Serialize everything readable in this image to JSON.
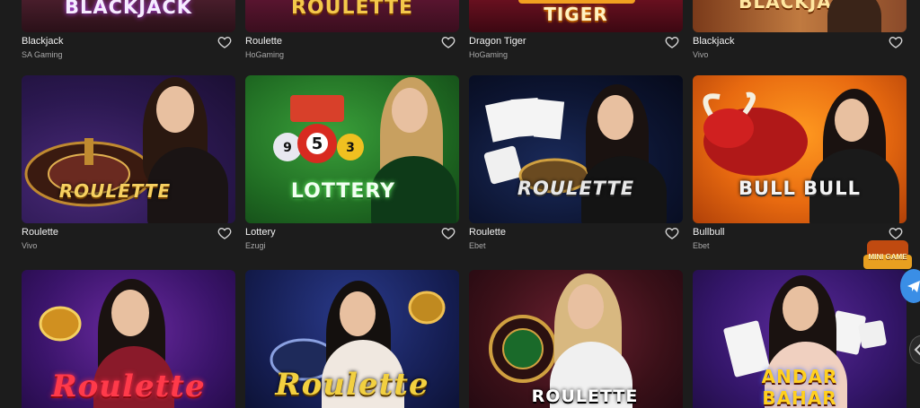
{
  "games": [
    {
      "title": "Blackjack",
      "provider": "SA Gaming",
      "logo": "BLACKJACK"
    },
    {
      "title": "Roulette",
      "provider": "HoGaming",
      "logo": "ROULETTE"
    },
    {
      "title": "Dragon Tiger",
      "provider": "HoGaming",
      "logo": "TIGER"
    },
    {
      "title": "Blackjack",
      "provider": "Vivo",
      "logo": "BLACKJACK"
    },
    {
      "title": "Roulette",
      "provider": "Vivo",
      "logo": "ROULETTE"
    },
    {
      "title": "Lottery",
      "provider": "Ezugi",
      "logo": "LOTTERY"
    },
    {
      "title": "Roulette",
      "provider": "Ebet",
      "logo": "ROULETTE"
    },
    {
      "title": "Bullbull",
      "provider": "Ebet",
      "logo": "BULL BULL"
    },
    {
      "logo": "Roulette"
    },
    {
      "logo": "Roulette"
    },
    {
      "logo": "ROULETTE"
    },
    {
      "logo": "ANDAR BAHAR"
    }
  ],
  "lottery_card": {
    "balls": [
      "9",
      "5",
      "3"
    ]
  },
  "widgets": {
    "mini_game_label": "MINI GAME"
  },
  "colors": {
    "background": "#1c1c1c",
    "title": "#f2f2f2",
    "provider": "#a9a9a9",
    "accent_gold": "#e8b84a"
  }
}
